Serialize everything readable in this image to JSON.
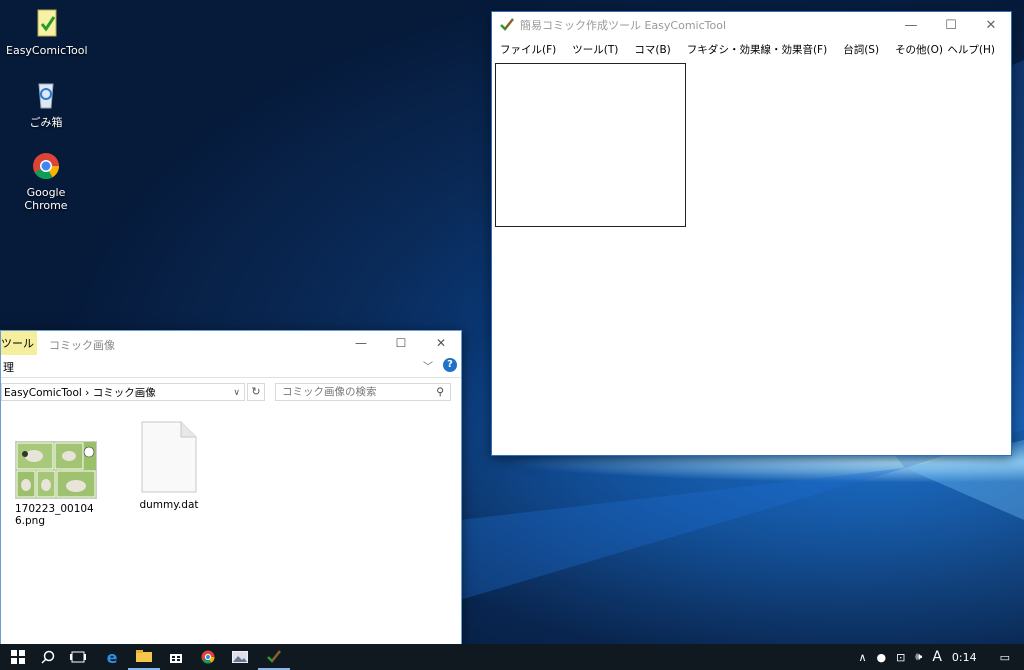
{
  "desktop": {
    "icons": [
      {
        "label": "EasyComicTool",
        "icon": "easycomictool-icon"
      },
      {
        "label": "ごみ箱",
        "icon": "recycle-bin-icon"
      },
      {
        "label": "Google Chrome",
        "icon": "chrome-icon"
      }
    ]
  },
  "app_window": {
    "title": "簡易コミック作成ツール EasyComicTool",
    "buttons": {
      "minimize": "—",
      "maximize": "☐",
      "close": "✕"
    },
    "menu": [
      "ファイル(F)",
      "ツール(T)",
      "コマ(B)",
      "フキダシ・効果線・効果音(F)",
      "台詞(S)",
      "その他(O)"
    ],
    "help_menu": "ヘルプ(H)"
  },
  "explorer": {
    "tool_tab": "ツール",
    "manage_label": "理",
    "title": "コミック画像",
    "breadcrumb": "EasyComicTool  ›  コミック画像",
    "search_placeholder": "コミック画像の検索",
    "help": "?",
    "files": [
      {
        "name": "170223_001046.png",
        "type": "image"
      },
      {
        "name": "dummy.dat",
        "type": "file"
      }
    ]
  },
  "taskbar": {
    "apps": [
      "start-icon",
      "search-icon",
      "task-view-icon",
      "edge-icon",
      "file-explorer-icon",
      "store-icon",
      "chrome-icon",
      "photos-icon",
      "easycomictool-icon"
    ],
    "tray": {
      "ime": "A",
      "time": "0:14"
    }
  },
  "colors": {
    "accent": "#1e73c8",
    "taskbar": "#101820",
    "tool_tab": "#f5ee9c"
  }
}
